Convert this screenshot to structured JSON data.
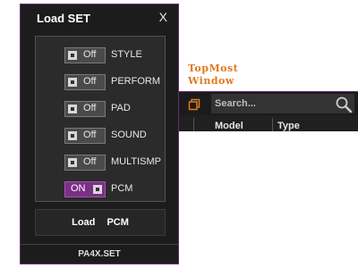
{
  "dialog": {
    "title": "Load SET",
    "close_label": "X",
    "options": [
      {
        "state": "Off",
        "name": "STYLE",
        "on": false
      },
      {
        "state": "Off",
        "name": "PERFORM",
        "on": false
      },
      {
        "state": "Off",
        "name": "PAD",
        "on": false
      },
      {
        "state": "Off",
        "name": "SOUND",
        "on": false
      },
      {
        "state": "Off",
        "name": "MULTISMP",
        "on": false
      },
      {
        "state": "ON",
        "name": "PCM",
        "on": true
      }
    ],
    "load_button": "Load PCM",
    "footer": "PA4X.SET"
  },
  "topmost": {
    "line1": "TopMost",
    "line2": "Window"
  },
  "background_window": {
    "search_placeholder": "Search...",
    "columns": [
      "Model",
      "Type"
    ]
  },
  "colors": {
    "accent": "#7b2f86",
    "orange": "#e07a1e",
    "dark": "#1c1c1c"
  }
}
